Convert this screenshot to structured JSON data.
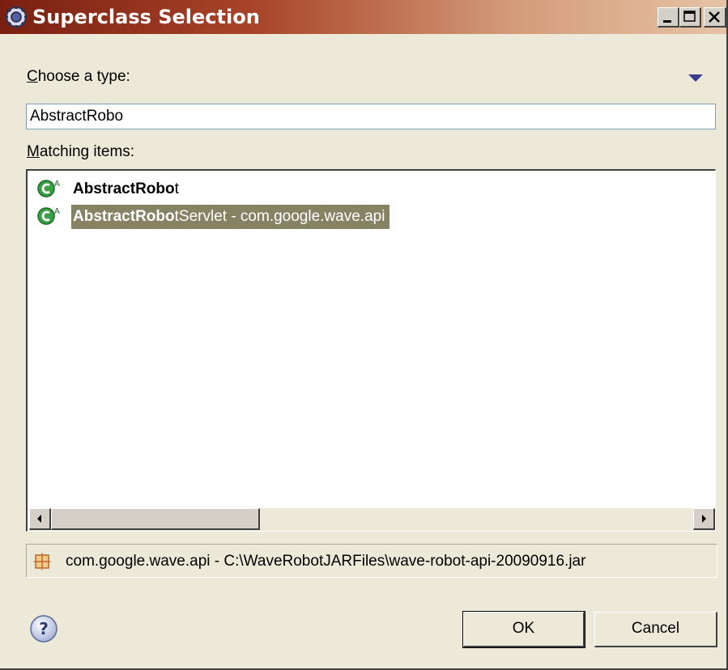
{
  "window": {
    "title": "Superclass Selection",
    "title_icon": "eclipse-gear-icon",
    "controls": [
      "minimize",
      "maximize",
      "close"
    ]
  },
  "filter": {
    "label": "Choose a type:",
    "label_mnemonic": "C",
    "label_rest": "hoose a type:",
    "value": "AbstractRobo",
    "menu_icon": "view-menu-triangle-icon"
  },
  "matching": {
    "label": "Matching items:",
    "label_mnemonic": "M",
    "label_rest": "atching items:",
    "items": [
      {
        "icon": "abstract-class-icon",
        "bold": "AbstractRobo",
        "rest": "t",
        "selected": false
      },
      {
        "icon": "abstract-class-icon",
        "bold": "AbstractRobo",
        "rest": "tServlet - com.google.wave.api",
        "selected": true
      }
    ]
  },
  "location": {
    "icon": "package-icon",
    "text": "com.google.wave.api - C:\\WaveRobotJARFiles\\wave-robot-api-20090916.jar"
  },
  "buttons": {
    "help_icon": "help-icon",
    "ok": "OK",
    "cancel": "Cancel"
  },
  "colors": {
    "title_start": "#7a1f10",
    "title_end": "#e6c3a6",
    "selection": "#868264",
    "dialog_bg": "#ece9d8"
  }
}
